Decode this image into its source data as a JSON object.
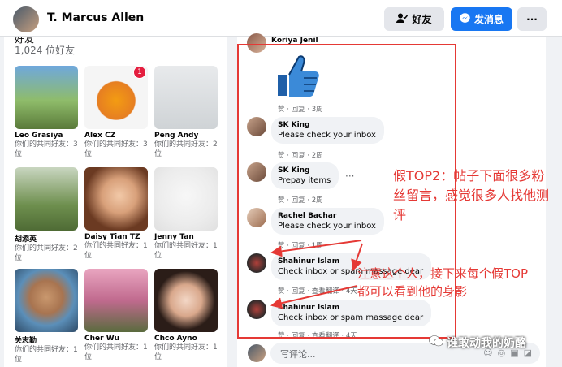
{
  "header": {
    "name": "T. Marcus Allen",
    "friend_btn": "好友",
    "msg_btn": "发消息",
    "more_btn": "···"
  },
  "friends": {
    "heading": "好友",
    "count": "1,024 位好友",
    "list": [
      {
        "name": "Leo Grasiya",
        "mutual": "你们的共同好友：3 位",
        "badge": ""
      },
      {
        "name": "Alex CZ",
        "mutual": "你们的共同好友：3 位",
        "badge": "1"
      },
      {
        "name": "Peng Andy",
        "mutual": "你们的共同好友：2 位",
        "badge": ""
      },
      {
        "name": "胡添英",
        "mutual": "你们的共同好友：2 位",
        "badge": ""
      },
      {
        "name": "Daisy Tian TZ",
        "mutual": "你们的共同好友：1 位",
        "badge": ""
      },
      {
        "name": "Jenny Tan",
        "mutual": "你们的共同好友：1 位",
        "badge": ""
      },
      {
        "name": "关志勤",
        "mutual": "你们的共同好友：1 位",
        "badge": ""
      },
      {
        "name": "Cher Wu",
        "mutual": "你们的共同好友：1 位",
        "badge": ""
      },
      {
        "name": "Chco Ayno",
        "mutual": "你们的共同好友：1 位",
        "badge": ""
      }
    ]
  },
  "comments": [
    {
      "name": "Koriya Jenil",
      "text": "",
      "meta": "赞 · 回复 · 3周"
    },
    {
      "name": "SK King",
      "text": "Please check your inbox",
      "meta": "赞 · 回复 · 2周"
    },
    {
      "name": "SK King",
      "text": "Prepay items",
      "meta": "赞 · 回复 · 2周"
    },
    {
      "name": "Rachel Bachar",
      "text": "Please check your inbox",
      "meta": "赞 · 回复 · 1周"
    },
    {
      "name": "Shahinur Islam",
      "text": "Check inbox or spam massage dear",
      "meta": "赞 · 回复 · 查看翻译 · 4天"
    },
    {
      "name": "Shahinur Islam",
      "text": "Check inbox or spam massage dear",
      "meta": "赞 · 回复 · 查看翻译 · 4天"
    }
  ],
  "comment_input": {
    "placeholder": "写评论..."
  },
  "annotations": {
    "top": "假TOP2：帖子下面很多粉丝留言，感觉很多人找他测评",
    "bottom": "注意这个人，接下来每个假TOP都可以看到他的身影"
  },
  "watermark": "谁敢动我的奶酪",
  "colors": {
    "accent": "#1877f2",
    "annotation": "#e53935"
  }
}
